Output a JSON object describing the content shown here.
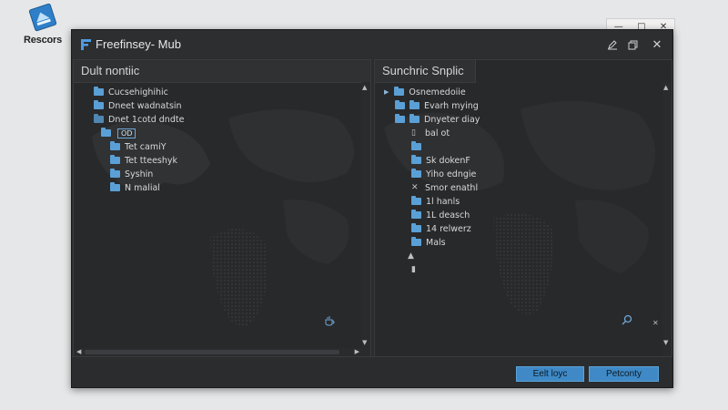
{
  "desktop": {
    "icon_label": "Rescors",
    "icon_name": "tilted-blue-app-icon"
  },
  "background_window": {
    "controls": [
      "minimize",
      "restore",
      "close"
    ]
  },
  "window": {
    "title": "Freefinsey- Mub",
    "logo_icon": "app-logo-icon",
    "title_buttons": [
      "pen-icon",
      "restore-icon",
      "close-icon"
    ]
  },
  "left_pane": {
    "header": "Dult nontiic",
    "items": [
      {
        "label": "Cucsehighihic",
        "indent": 0
      },
      {
        "label": "Dneet wadnatsin",
        "indent": 0
      },
      {
        "label": "Dnet 1cotd dndte",
        "indent": 0
      },
      {
        "label": "",
        "tag": "OD",
        "indent": 1
      },
      {
        "label": "Tet camiY",
        "indent": 2
      },
      {
        "label": "Tet tteeshyk",
        "indent": 2
      },
      {
        "label": "Syshin",
        "indent": 2
      },
      {
        "label": "N malial",
        "indent": 2
      }
    ]
  },
  "right_pane": {
    "header": "Sunchric Snplic",
    "items": [
      {
        "label": "Osnemedoiie",
        "kind": "arrow-folder",
        "indent": 0
      },
      {
        "label": "Evarh mying",
        "kind": "folder2",
        "indent": 1
      },
      {
        "label": "Dnyeter diay",
        "kind": "folder2",
        "indent": 1
      },
      {
        "label": "bal ot",
        "kind": "doc",
        "indent": 2
      },
      {
        "label": "",
        "kind": "folder",
        "indent": 2
      },
      {
        "label": "Sk dokenF",
        "kind": "folder",
        "indent": 2
      },
      {
        "label": "Yiho edngie",
        "kind": "folder",
        "indent": 2
      },
      {
        "label": "Smor enathl",
        "kind": "x",
        "indent": 2
      },
      {
        "label": "1l hanls",
        "kind": "folder",
        "indent": 2
      },
      {
        "label": "1L deasch",
        "kind": "folder",
        "indent": 2
      },
      {
        "label": "14 relwerz",
        "kind": "folder",
        "indent": 2
      },
      {
        "label": "Mals",
        "kind": "folder",
        "indent": 2
      },
      {
        "label": "",
        "kind": "drive",
        "indent": 2
      },
      {
        "label": "",
        "kind": "file",
        "indent": 2
      }
    ]
  },
  "footer": {
    "button_primary": "Eelt loyc",
    "button_secondary": "Petconty"
  },
  "colors": {
    "accent": "#3f8ac6",
    "folder": "#5aa0d6",
    "window_bg": "#2b2c2e",
    "desktop_bg": "#e6e7e8"
  }
}
